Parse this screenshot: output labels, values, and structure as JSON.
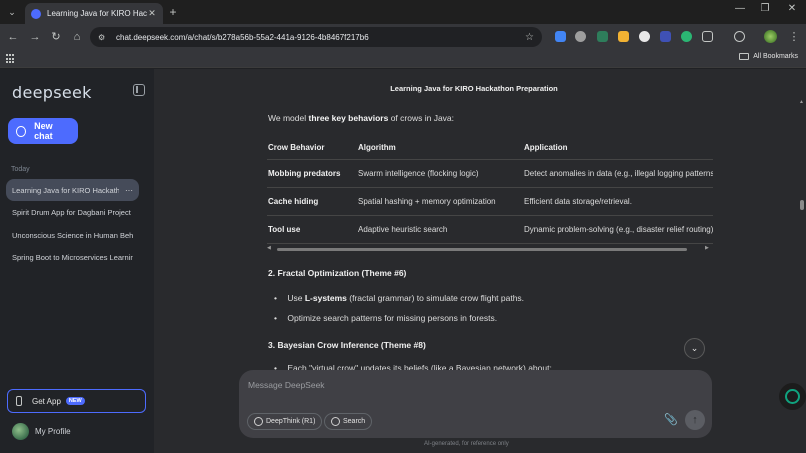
{
  "browser": {
    "tab_title": "Learning Java for KIRO Hackathon",
    "tab_close": "✕",
    "new_tab": "+",
    "url": "chat.deepseek.com/a/chat/s/b278a56b-55a2-441a-9126-4b8467f217b6",
    "all_bookmarks": "All Bookmarks",
    "controls": {
      "minimize": "—",
      "restore": "❐",
      "close": "✕"
    }
  },
  "sidebar": {
    "logo": "deepseek",
    "new_chat": "New chat",
    "section_today": "Today",
    "chats": [
      {
        "title": "Learning Java for KIRO Hackathon",
        "active": true
      },
      {
        "title": "Spirit Drum App for Dagbani Project",
        "active": false
      },
      {
        "title": "Unconscious Science in Human Behavior",
        "active": false
      },
      {
        "title": "Spring Boot to Microservices Learning",
        "active": false
      }
    ],
    "more": "···",
    "get_app": "Get App",
    "badge_new": "NEW",
    "profile": "My Profile"
  },
  "conversation": {
    "title": "Learning Java for KIRO Hackathon Preparation",
    "intro_prefix": "We model ",
    "intro_bold": "three key behaviors",
    "intro_suffix": " of crows in Java:",
    "table": {
      "headers": [
        "Crow Behavior",
        "Algorithm",
        "Application"
      ],
      "rows": [
        [
          "Mobbing predators",
          "Swarm intelligence (flocking logic)",
          "Detect anomalies in data (e.g., illegal logging patterns)"
        ],
        [
          "Cache hiding",
          "Spatial hashing + memory optimization",
          "Efficient data storage/retrieval."
        ],
        [
          "Tool use",
          "Adaptive heuristic search",
          "Dynamic problem-solving (e.g., disaster relief routing)"
        ]
      ]
    },
    "section2_title": "2. Fractal Optimization (Theme #6)",
    "section2_bullet1_prefix": "Use ",
    "section2_bullet1_bold": "L-systems",
    "section2_bullet1_suffix": " (fractal grammar) to simulate crow flight paths.",
    "section2_bullet2": "Optimize search patterns for missing persons in forests.",
    "section3_title": "3. Bayesian Crow Inference (Theme #8)",
    "section3_partial": "Each \"virtual crow\" updates its beliefs (like a Bayesian network) about:"
  },
  "composer": {
    "placeholder": "Message DeepSeek",
    "deepthink": "DeepThink (R1)",
    "search": "Search",
    "footnote": "AI-generated, for reference only"
  },
  "colors": {
    "accent": "#4d6bfe",
    "sidebar_bg": "#212327",
    "main_bg": "#292a2d"
  }
}
